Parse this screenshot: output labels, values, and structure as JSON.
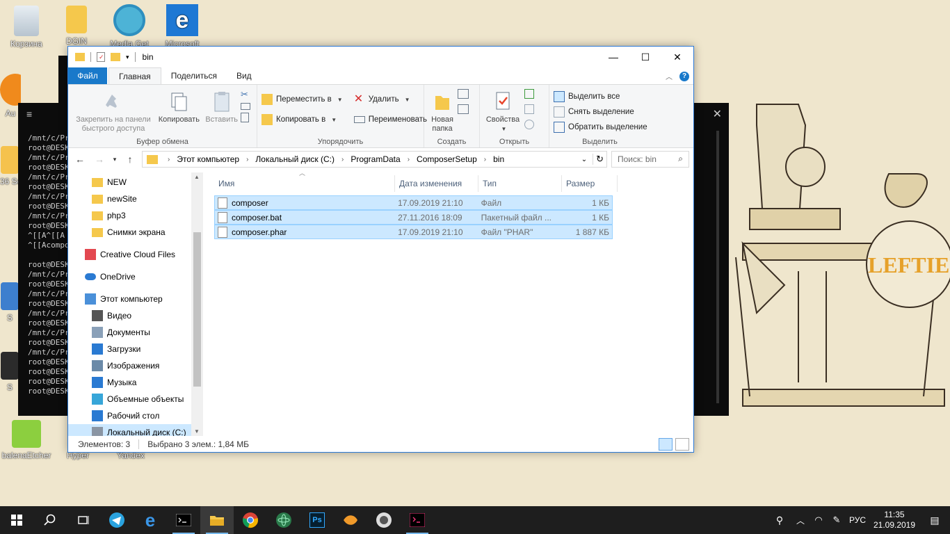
{
  "desktop": {
    "icons": [
      {
        "label": "Корзина"
      },
      {
        "label": "DGIN"
      },
      {
        "label": "Media Get"
      },
      {
        "label": "Microsoft"
      },
      {
        "label": "Au"
      },
      {
        "label": "36 Se"
      },
      {
        "label": "S"
      },
      {
        "label": "S"
      },
      {
        "label": "balenaEtcher"
      },
      {
        "label": "Hyper"
      },
      {
        "label": "Yandex"
      }
    ]
  },
  "terminal": {
    "lines": "/mnt/c/Pro\nroot@DESKT\n/mnt/c/Pro\nroot@DESKT\n/mnt/c/Pro\nroot@DESKT\n/mnt/c/Pro\nroot@DESKT\n/mnt/c/Pro\nroot@DESKT\n^[[A^[[A\n^[[Acompo\n\nroot@DESKT\n/mnt/c/Pro\nroot@DESKT\n/mnt/c/Pro\nroot@DESKT\n/mnt/c/Pro\nroot@DESKT\n/mnt/c/Pro\nroot@DESKT\n/mnt/c/Pro\nroot@DESKT\nroot@DESKT\nroot@DESKT\nroot@DESKT"
  },
  "window": {
    "title": "bin",
    "tabs": {
      "file": "Файл",
      "home": "Главная",
      "share": "Поделиться",
      "view": "Вид"
    },
    "ribbon": {
      "pin_quick": "Закрепить на панели быстрого доступа",
      "copy": "Копировать",
      "paste": "Вставить",
      "clipboard_group": "Буфер обмена",
      "move_to": "Переместить в",
      "copy_to": "Копировать в",
      "delete": "Удалить",
      "rename": "Переименовать",
      "organize_group": "Упорядочить",
      "new_folder": "Новая папка",
      "create_group": "Создать",
      "properties": "Свойства",
      "open_group": "Открыть",
      "select_all": "Выделить все",
      "select_none": "Снять выделение",
      "invert_selection": "Обратить выделение",
      "select_group": "Выделить"
    },
    "breadcrumb": [
      "Этот компьютер",
      "Локальный диск (C:)",
      "ProgramData",
      "ComposerSetup",
      "bin"
    ],
    "search_placeholder": "Поиск: bin",
    "nav": [
      {
        "label": "NEW",
        "icon": "folder-icon"
      },
      {
        "label": "newSite",
        "icon": "folder-icon"
      },
      {
        "label": "php3",
        "icon": "folder-icon"
      },
      {
        "label": "Снимки экрана",
        "icon": "folder-icon"
      },
      {
        "label": "Creative Cloud Files",
        "icon": "creative-cloud-icon"
      },
      {
        "label": "OneDrive",
        "icon": "onedrive-icon"
      },
      {
        "label": "Этот компьютер",
        "icon": "computer-icon"
      },
      {
        "label": "Видео",
        "icon": "video-icon"
      },
      {
        "label": "Документы",
        "icon": "documents-icon"
      },
      {
        "label": "Загрузки",
        "icon": "downloads-icon"
      },
      {
        "label": "Изображения",
        "icon": "pictures-icon"
      },
      {
        "label": "Музыка",
        "icon": "music-icon"
      },
      {
        "label": "Объемные объекты",
        "icon": "3d-objects-icon"
      },
      {
        "label": "Рабочий стол",
        "icon": "desktop-icon"
      },
      {
        "label": "Локальный диск (C:)",
        "icon": "drive-icon"
      }
    ],
    "columns": {
      "name": "Имя",
      "date": "Дата изменения",
      "type": "Тип",
      "size": "Размер"
    },
    "files": [
      {
        "name": "composer",
        "date": "17.09.2019 21:10",
        "type": "Файл",
        "size": "1 КБ"
      },
      {
        "name": "composer.bat",
        "date": "27.11.2016 18:09",
        "type": "Пакетный файл ...",
        "size": "1 КБ"
      },
      {
        "name": "composer.phar",
        "date": "17.09.2019 21:10",
        "type": "Файл \"PHAR\"",
        "size": "1 887 КБ"
      }
    ],
    "status": {
      "items": "Элементов: 3",
      "selected": "Выбрано 3 элем.: 1,84 МБ"
    }
  },
  "taskbar": {
    "lang": "РУС",
    "time": "11:35",
    "date": "21.09.2019"
  },
  "colors": {
    "accent": "#1979ca",
    "selection": "#cce8ff",
    "taskbar": "#1e1e1e"
  }
}
